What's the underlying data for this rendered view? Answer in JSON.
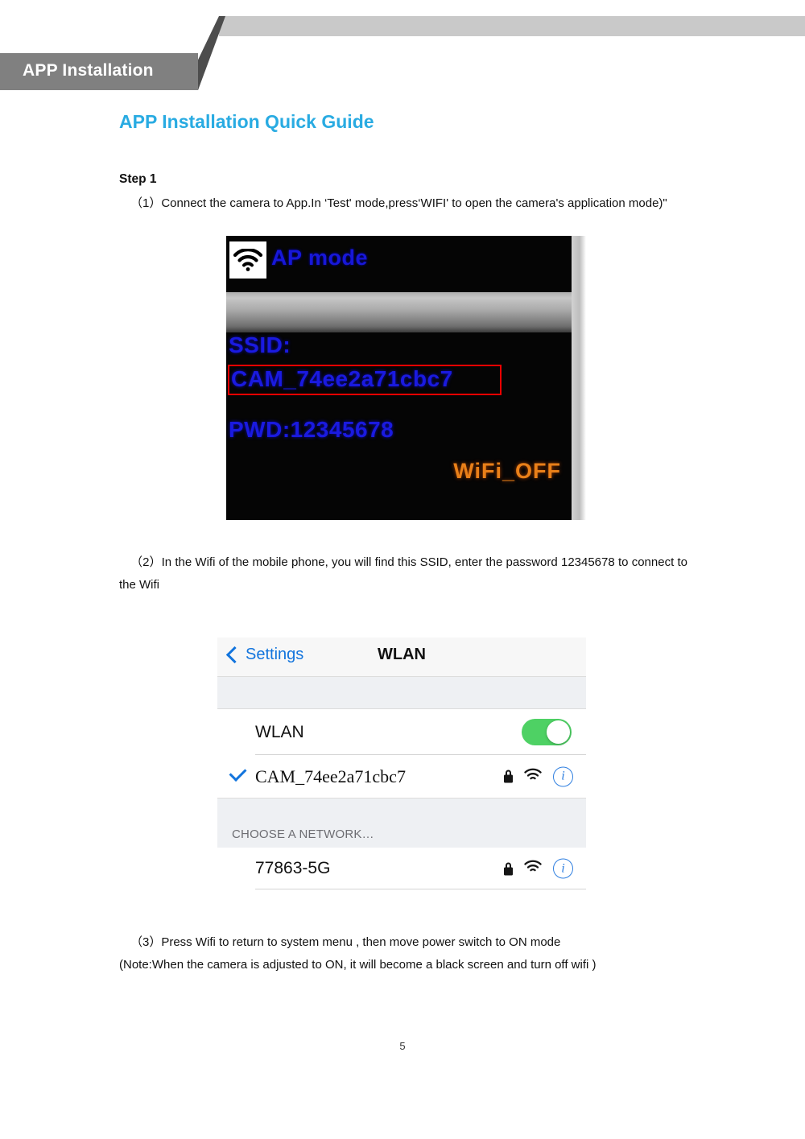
{
  "header": {
    "tab_label": "APP Installation"
  },
  "page": {
    "heading": "APP Installation Quick Guide",
    "step_title": "Step 1",
    "paragraph_1": "（1）Connect the camera to App.In ‘Test' mode,press‘WIFI' to open the camera's application mode)\"",
    "paragraph_2": "（2）In the Wifi of the mobile phone, you will find this SSID, enter the password 12345678 to connect to the Wifi",
    "paragraph_3_line1": "（3）Press Wifi to return to system menu , then move power switch to ON mode",
    "paragraph_3_line2": "(Note:When the camera is adjusted to ON, it will become a black screen and turn off wifi )",
    "page_number": "5"
  },
  "led_screen": {
    "wifi_icon": "wifi-icon",
    "mode_label": "AP mode",
    "ssid_label": "SSID:",
    "ssid_value": "CAM_74ee2a71cbc7",
    "password_line": "PWD:12345678",
    "wifi_status": "WiFi_OFF",
    "highlight_color": "#ee0000",
    "text_color": "#1a1ae0",
    "status_color": "#e98019"
  },
  "ios_settings": {
    "back_label": "Settings",
    "title": "WLAN",
    "wlan_toggle_label": "WLAN",
    "wlan_toggle_state": "on",
    "toggle_color": "#4ed164",
    "connected_network": "CAM_74ee2a71cbc7",
    "section_header": "CHOOSE A NETWORK…",
    "networks": [
      {
        "name": "77863-5G",
        "locked": true,
        "signal": "wifi-icon",
        "info": "i"
      }
    ],
    "accent_color": "#1274dd"
  }
}
